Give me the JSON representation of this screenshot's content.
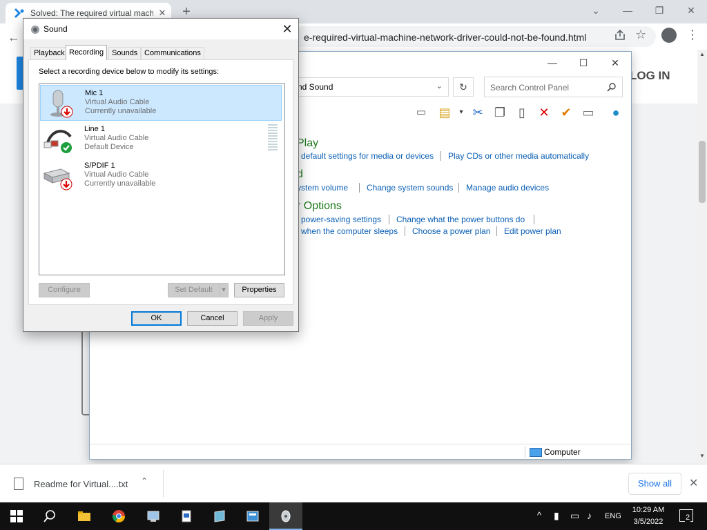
{
  "browser": {
    "tab_title": "Solved: The required virtual mach",
    "tab_close": "✕",
    "new_tab": "+",
    "window_controls": {
      "tablist": "⌄",
      "minimize": "—",
      "restore": "❐",
      "close": "✕"
    },
    "back": "←",
    "url_visible": "e-required-virtual-machine-network-driver-could-not-be-found.html",
    "star": "☆",
    "menu": "⋮"
  },
  "webpage": {
    "login_label": "LOG IN",
    "accent_color": "#1e88e5"
  },
  "control_panel": {
    "window_controls": {
      "minimize": "—",
      "maximize": "☐",
      "close": "✕"
    },
    "address_text": "nd Sound",
    "address_dropdown": "⌄",
    "refresh": "↻",
    "search_placeholder": "Search Control Panel",
    "sections": [
      {
        "heading": "Play",
        "links": [
          "default settings for media or devices",
          "Play CDs or other media automatically"
        ]
      },
      {
        "heading": "d",
        "links": [
          "ystem volume",
          "Change system sounds",
          "Manage audio devices"
        ]
      },
      {
        "heading": "r Options",
        "links": [
          "power-saving settings",
          "Change what the power buttons do",
          "when the computer sleeps",
          "Choose a power plan",
          "Edit power plan"
        ]
      }
    ],
    "status_text": "Computer"
  },
  "sound_dialog": {
    "title": "Sound",
    "close": "✕",
    "tabs": [
      "Playback",
      "Recording",
      "Sounds",
      "Communications"
    ],
    "active_tab": "Recording",
    "instruction": "Select a recording device below to modify its settings:",
    "devices": [
      {
        "name": "Mic 1",
        "description": "Virtual Audio Cable",
        "status": "Currently unavailable",
        "icon": "microphone-icon",
        "badge": "down-arrow-badge",
        "selected": true
      },
      {
        "name": "Line 1",
        "description": "Virtual Audio Cable",
        "status": "Default Device",
        "icon": "line-in-cable-icon",
        "badge": "checkmark-badge",
        "selected": false
      },
      {
        "name": "S/PDIF 1",
        "description": "Virtual Audio Cable",
        "status": "Currently unavailable",
        "icon": "spdif-device-icon",
        "badge": "down-arrow-badge",
        "selected": false
      }
    ],
    "buttons": {
      "configure": "Configure",
      "set_default": "Set Default",
      "set_default_arrow": "▾",
      "properties": "Properties",
      "ok": "OK",
      "cancel": "Cancel",
      "apply": "Apply"
    }
  },
  "download_bar": {
    "file_name": "Readme for Virtual....txt",
    "chevron": "⌃",
    "show_all": "Show all",
    "close": "✕"
  },
  "taskbar": {
    "apps": [
      "start-icon",
      "search-icon",
      "file-explorer-icon",
      "chrome-icon",
      "app-icon-1",
      "app-icon-2",
      "app-icon-3",
      "app-icon-4",
      "sound-settings-icon"
    ],
    "tray_chevron": "^",
    "language": "ENG",
    "time": "10:29 AM",
    "date": "3/5/2022",
    "notification_count": "2"
  }
}
